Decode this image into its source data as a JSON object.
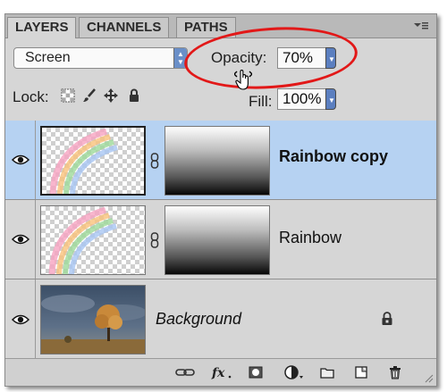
{
  "tabs": [
    {
      "label": "LAYERS",
      "active": true
    },
    {
      "label": "CHANNELS",
      "active": false
    },
    {
      "label": "PATHS",
      "active": false
    }
  ],
  "controls": {
    "blend_mode": "Screen",
    "opacity_label": "Opacity:",
    "opacity_value": "70%",
    "lock_label": "Lock:",
    "fill_label": "Fill:",
    "fill_value": "100%"
  },
  "layers": [
    {
      "name": "Rainbow copy",
      "selected": true,
      "visible": true,
      "has_mask": true,
      "locked": false
    },
    {
      "name": "Rainbow",
      "selected": false,
      "visible": true,
      "has_mask": true,
      "locked": false
    },
    {
      "name": "Background",
      "selected": false,
      "visible": true,
      "has_mask": false,
      "locked": true
    }
  ],
  "bottom_icons": [
    "link-layers-icon",
    "fx-icon",
    "add-mask-icon",
    "adjustment-layer-icon",
    "new-group-icon",
    "new-layer-icon",
    "trash-icon"
  ],
  "colors": {
    "selected_row": "#b6d2f2",
    "annotation": "#e21818",
    "spinner": "#5b7fc0"
  }
}
